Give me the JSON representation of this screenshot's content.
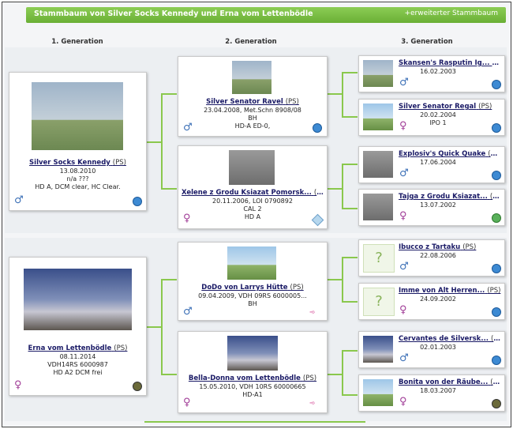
{
  "header": {
    "title": "Stammbaum von Silver Socks Kennedy und Erna vom Lettenbödle",
    "extended_link": "+erweiterter Stammbaum"
  },
  "generations": [
    "1. Generation",
    "2. Generation",
    "3. Generation"
  ],
  "gen1": [
    {
      "name": "Silver Socks Kennedy",
      "reg": "(PS)",
      "lines": [
        "13.08.2010",
        "n/a ???",
        "HD A, DCM clear, HC Clear."
      ],
      "sex": "♂"
    },
    {
      "name": "Erna vom Lettenbödle",
      "reg": "(PS)",
      "lines": [
        "08.11.2014",
        "VDH14RS 6000987",
        "HD A2 DCM frei"
      ],
      "sex": "♀"
    }
  ],
  "gen2": [
    {
      "name": "Silver Senator Ravel",
      "reg": "(PS)",
      "lines": [
        "23.04.2008, Met.Schn 8908/08",
        "BH",
        "HD-A ED-0,"
      ],
      "sex": "♂"
    },
    {
      "name": "Xelene z Grodu Ksiazat Pomorsk...",
      "reg": "(PS)",
      "lines": [
        "20.11.2006, LOI 0790892",
        "CAL 2",
        "HD A"
      ],
      "sex": "♀"
    },
    {
      "name": "DoDo von Larrys Hütte",
      "reg": "(PS)",
      "lines": [
        "09.04.2009, VDH 09RS 6000005...",
        "BH"
      ],
      "sex": "♂"
    },
    {
      "name": "Bella-Donna vom Lettenbödle",
      "reg": "(PS)",
      "lines": [
        "15.05.2010, VDH 10RS 60000665",
        "HD-A1"
      ],
      "sex": "♀"
    }
  ],
  "gen3": [
    {
      "name": "Skansen's Rasputin Ig...",
      "reg": "(PS)",
      "lines": [
        "16.02.2003"
      ],
      "sex": "♂"
    },
    {
      "name": "Silver Senator Regal",
      "reg": "(PS)",
      "lines": [
        "20.02.2004",
        "IPO 1"
      ],
      "sex": "♀"
    },
    {
      "name": "Explosiv's Quick Quake",
      "reg": "(PS)",
      "lines": [
        "17.06.2004"
      ],
      "sex": "♂"
    },
    {
      "name": "Tajga z Grodu Ksiazat...",
      "reg": "(PS)",
      "lines": [
        "13.07.2002"
      ],
      "sex": "♀"
    },
    {
      "name": "Ibucco z Tartaku",
      "reg": "(PS)",
      "lines": [
        "22.08.2006"
      ],
      "sex": "♂"
    },
    {
      "name": "Imme von Alt Herren...",
      "reg": "(PS)",
      "lines": [
        "24.09.2002"
      ],
      "sex": "♀"
    },
    {
      "name": "Cervantes de Silversk...",
      "reg": "(PS)",
      "lines": [
        "02.01.2003"
      ],
      "sex": "♂"
    },
    {
      "name": "Bonita von der Räube...",
      "reg": "(PS)",
      "lines": [
        "18.03.2007"
      ],
      "sex": "♀"
    }
  ]
}
